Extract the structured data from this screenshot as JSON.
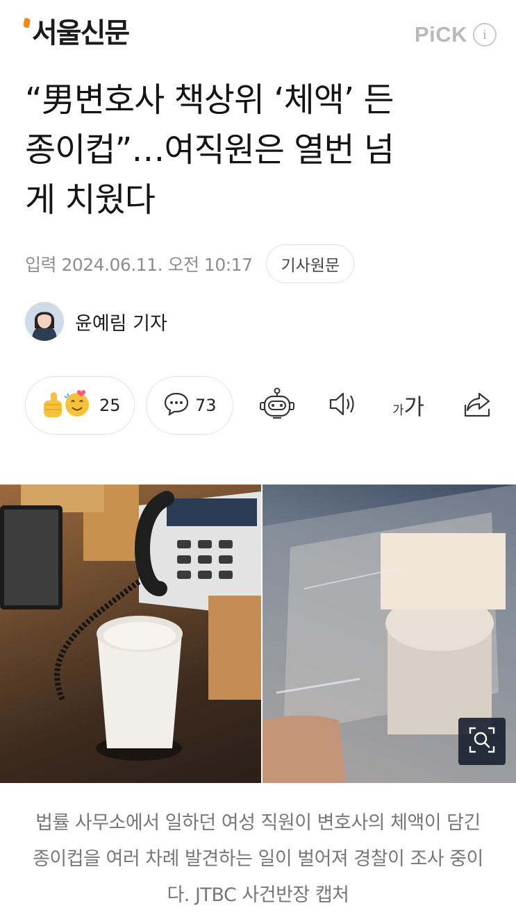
{
  "header": {
    "logo_text": "서울신문",
    "pick_label": "PiCK",
    "info_icon": "info-icon"
  },
  "article": {
    "headline_lines": [
      "“男변호사 책상위 ‘체액’ 든",
      "종이컵”…여직원은 열번 넘",
      "게 치웠다"
    ],
    "date_line": "입력 2024.06.11. 오전 10:17",
    "original_button": "기사원문",
    "reporter_name": "윤예림 기자"
  },
  "actions": {
    "reaction_count": "25",
    "comment_count": "73",
    "icons": [
      "reaction-emoji-icon",
      "comment-icon",
      "summary-bot-icon",
      "speaker-icon",
      "font-size-icon",
      "share-icon"
    ],
    "font_size_small": "가",
    "font_size_large": "가"
  },
  "photo": {
    "zoom_icon": "zoom-search-icon",
    "caption": "법률 사무소에서 일하던 여성 직원이 변호사의 체액이 담긴 종이컵을 여러 차례 발견하는 일이 벌어져 경찰이 조사 중이다. JTBC 사건반장 캡처"
  },
  "colors": {
    "logo_accent": "#f28a1a",
    "muted_text": "#8d8d8d",
    "border": "#e3e3e3"
  }
}
